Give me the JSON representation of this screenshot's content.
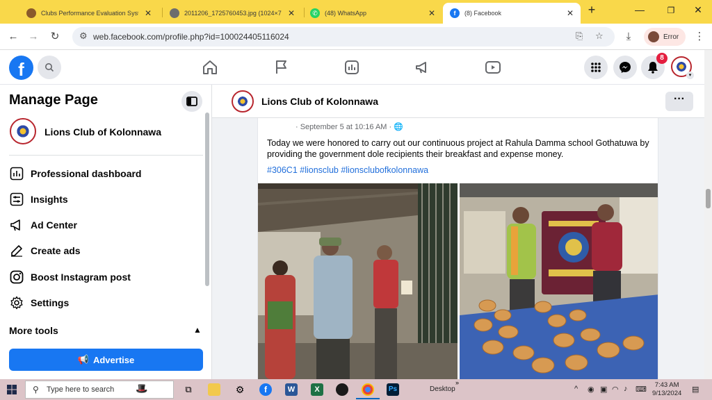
{
  "browser": {
    "tabs": [
      {
        "title": "Clubs Performance Evaluation Syst",
        "active": false
      },
      {
        "title": "2011206_1725760453.jpg (1024×7",
        "active": false
      },
      {
        "title": "(48) WhatsApp",
        "active": false
      },
      {
        "title": "(8) Facebook",
        "active": true
      }
    ],
    "new_tab": "+",
    "url": "web.facebook.com/profile.php?id=100024405116024",
    "profile_label": "Error",
    "colors": {
      "tabstrip": "#f9d84a",
      "active_tab": "#ffffff"
    }
  },
  "fb_header": {
    "logo": "f",
    "notification_count": "8",
    "nav_icons": [
      "home-icon",
      "flag-icon",
      "pages-icon",
      "megaphone-icon",
      "video-icon"
    ],
    "right_icons": [
      "menu-grid-icon",
      "messenger-icon",
      "bell-icon",
      "profile-avatar"
    ]
  },
  "sidebar": {
    "title": "Manage Page",
    "page_name": "Lions Club of Kolonnawa",
    "items": [
      {
        "label": "Professional dashboard",
        "icon": "dashboard-icon"
      },
      {
        "label": "Insights",
        "icon": "insights-icon"
      },
      {
        "label": "Ad Center",
        "icon": "megaphone-icon"
      },
      {
        "label": "Create ads",
        "icon": "edit-icon"
      },
      {
        "label": "Boost Instagram post",
        "icon": "instagram-icon"
      },
      {
        "label": "Settings",
        "icon": "gear-icon"
      }
    ],
    "more_tools": "More tools",
    "advertise": "Advertise"
  },
  "page_bar": {
    "name": "Lions Club of Kolonnawa",
    "more": "···"
  },
  "post": {
    "time": "· September 5 at 10:16 AM · ",
    "text": "Today we were honored to carry out our continuous project at Rahula Damma school Gothatuwa by providing the government dole recipients their breakfast and expense money.",
    "tags": "#306C1 #lionsclub #lionsclubofkolonnawa"
  },
  "taskbar": {
    "search_placeholder": "Type here to search",
    "desktop_label": "Desktop",
    "time": "7:43 AM",
    "date": "9/13/2024"
  }
}
